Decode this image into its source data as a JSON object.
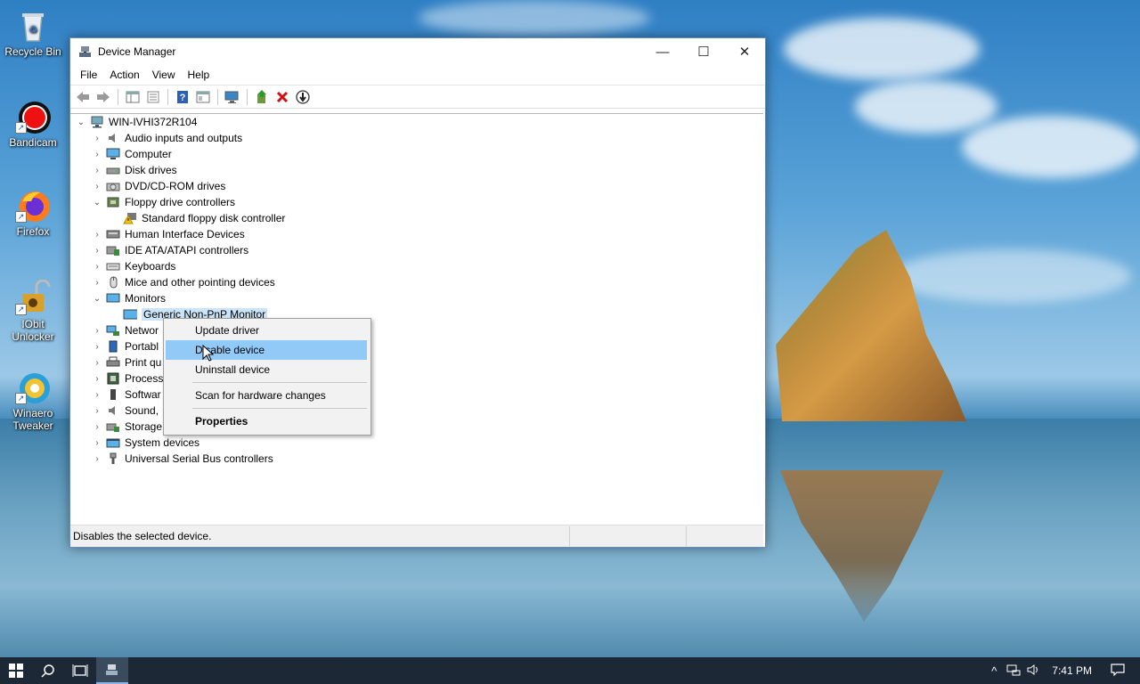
{
  "desktop": {
    "icons": [
      {
        "label": "Recycle Bin",
        "icon": "recycle-bin-icon"
      },
      {
        "label": "Bandicam",
        "icon": "bandicam-icon"
      },
      {
        "label": "Firefox",
        "icon": "firefox-icon"
      },
      {
        "label": "IObit Unlocker",
        "icon": "iobit-unlocker-icon"
      },
      {
        "label": "Winaero Tweaker",
        "icon": "winaero-tweaker-icon"
      }
    ]
  },
  "window": {
    "title": "Device Manager",
    "controls": {
      "minimize": "—",
      "maximize": "☐",
      "close": "✕"
    }
  },
  "menubar": {
    "items": [
      "File",
      "Action",
      "View",
      "Help"
    ]
  },
  "toolbar": {
    "buttons": [
      "back-icon",
      "forward-icon",
      "show-hide-console-tree-icon",
      "properties-sheet-icon",
      "help-icon",
      "view-icon",
      "monitor-scan-icon",
      "update-driver-icon",
      "uninstall-icon",
      "disable-device-icon"
    ]
  },
  "tree": {
    "root": "WIN-IVHI372R104",
    "items": [
      {
        "label": "Audio inputs and outputs",
        "expanded": false
      },
      {
        "label": "Computer",
        "expanded": false
      },
      {
        "label": "Disk drives",
        "expanded": false
      },
      {
        "label": "DVD/CD-ROM drives",
        "expanded": false
      },
      {
        "label": "Floppy drive controllers",
        "expanded": true
      },
      {
        "label": "Standard floppy disk controller",
        "child": true,
        "warning": true
      },
      {
        "label": "Human Interface Devices",
        "expanded": false
      },
      {
        "label": "IDE ATA/ATAPI controllers",
        "expanded": false
      },
      {
        "label": "Keyboards",
        "expanded": false
      },
      {
        "label": "Mice and other pointing devices",
        "expanded": false
      },
      {
        "label": "Monitors",
        "expanded": true
      },
      {
        "label": "Generic Non-PnP Monitor",
        "child": true,
        "selected": true
      },
      {
        "label": "Networ",
        "expanded": false
      },
      {
        "label": "Portabl",
        "expanded": false
      },
      {
        "label": "Print qu",
        "expanded": false
      },
      {
        "label": "Process",
        "expanded": false
      },
      {
        "label": "Softwar",
        "expanded": false
      },
      {
        "label": "Sound, ",
        "expanded": false
      },
      {
        "label": "Storage",
        "expanded": false
      },
      {
        "label": "System devices",
        "expanded": false
      },
      {
        "label": "Universal Serial Bus controllers",
        "expanded": false
      }
    ]
  },
  "context_menu": {
    "items": [
      {
        "label": "Update driver"
      },
      {
        "label": "Disable device",
        "highlighted": true
      },
      {
        "label": "Uninstall device"
      },
      {
        "label": "Scan for hardware changes"
      },
      {
        "label": "Properties",
        "bold": true
      }
    ]
  },
  "statusbar": {
    "text": "Disables the selected device."
  },
  "taskbar": {
    "clock": "7:41 PM",
    "colors": {
      "background": "#1c2836",
      "accent": "#8ab4e8"
    }
  }
}
